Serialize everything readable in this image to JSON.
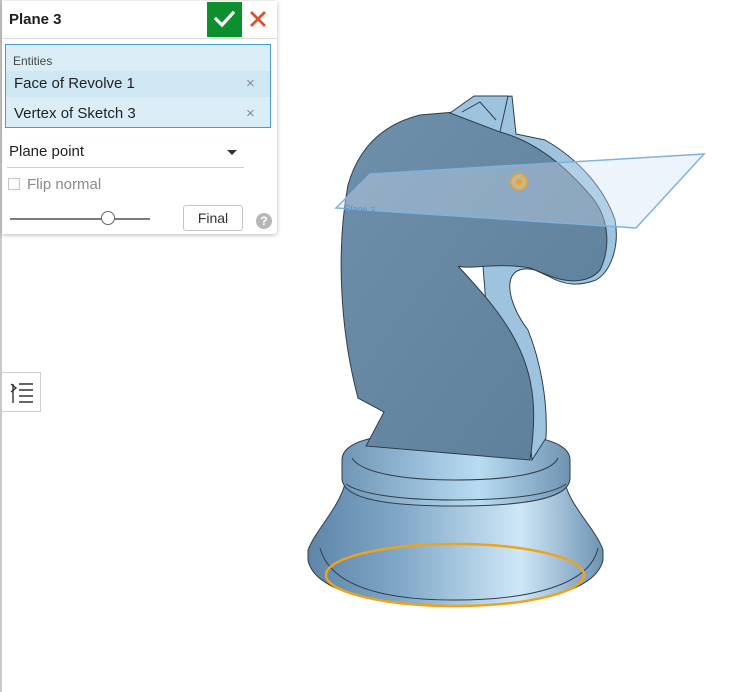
{
  "feature_dialog": {
    "title": "Plane 3",
    "entities_label": "Entities",
    "entities": [
      {
        "label": "Face of Revolve 1",
        "remove": "×"
      },
      {
        "label": "Vertex of Sketch 3",
        "remove": "×"
      }
    ],
    "plane_type": "Plane point",
    "flip_normal_label": "Flip normal",
    "flip_normal_checked": false,
    "final_label": "Final",
    "rollback_slider_value": 0.7,
    "help_glyph": "?"
  },
  "viewport": {
    "plane_label": "Plane 3",
    "colors": {
      "model_light": "#a9cde8",
      "model_mid": "#6f93b0",
      "model_dark": "#4d6d88",
      "selection": "#f0a21b",
      "plane_fill": "#cfe3f4",
      "plane_edge": "#7fb2dd"
    }
  },
  "icons": {
    "ok": "checkmark-icon",
    "cancel": "close-icon",
    "feature_list": "feature-list-icon",
    "help": "help-icon"
  }
}
